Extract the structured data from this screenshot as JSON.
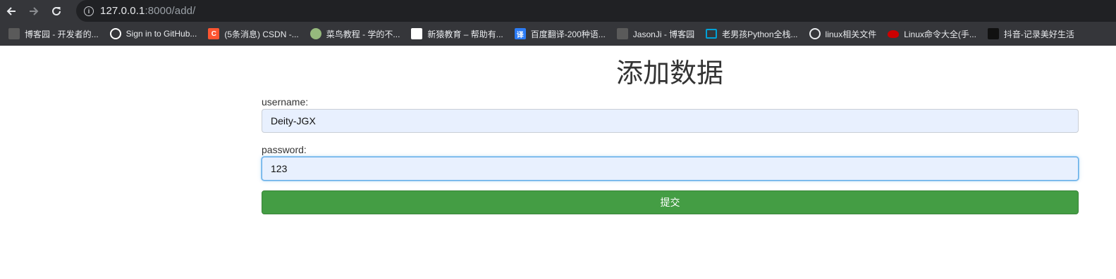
{
  "browser": {
    "url_host": "127.0.0.1",
    "url_path": ":8000/add/",
    "bookmarks": [
      {
        "label": "博客园 - 开发者的...",
        "icon": "cnblogs-icon",
        "color": "#5a5a5a"
      },
      {
        "label": "Sign in to GitHub...",
        "icon": "github-icon",
        "color": "#ffffff"
      },
      {
        "label": "(5条消息) CSDN -...",
        "icon": "csdn-icon",
        "color": "#fc5531",
        "glyph": "C"
      },
      {
        "label": "菜鸟教程 - 学的不...",
        "icon": "runoob-icon",
        "color": "#96b97d"
      },
      {
        "label": "新猿教育 – 帮助有...",
        "icon": "xinyuan-icon",
        "color": "#ffffff"
      },
      {
        "label": "百度翻译-200种语...",
        "icon": "baidu-translate-icon",
        "color": "#2c7cf6",
        "glyph": "译"
      },
      {
        "label": "JasonJi - 博客园",
        "icon": "cnblogs-icon",
        "color": "#5a5a5a"
      },
      {
        "label": "老男孩Python全栈...",
        "icon": "bilibili-icon",
        "color": "#00a1d6"
      },
      {
        "label": "linux相关文件",
        "icon": "globe-icon",
        "color": "#e8eaed"
      },
      {
        "label": "Linux命令大全(手...",
        "icon": "redhat-icon",
        "color": "#cc0000"
      },
      {
        "label": "抖音-记录美好生活",
        "icon": "douyin-icon",
        "color": "#111111"
      }
    ]
  },
  "page": {
    "title": "添加数据",
    "username_label": "username:",
    "username_value": "Deity-JGX",
    "password_label": "password:",
    "password_value": "123",
    "submit_label": "提交"
  },
  "colors": {
    "chrome_bg": "#35363a",
    "address_bg": "#202124",
    "input_autofill_bg": "#e8f0fe",
    "submit_green": "#449d44"
  }
}
